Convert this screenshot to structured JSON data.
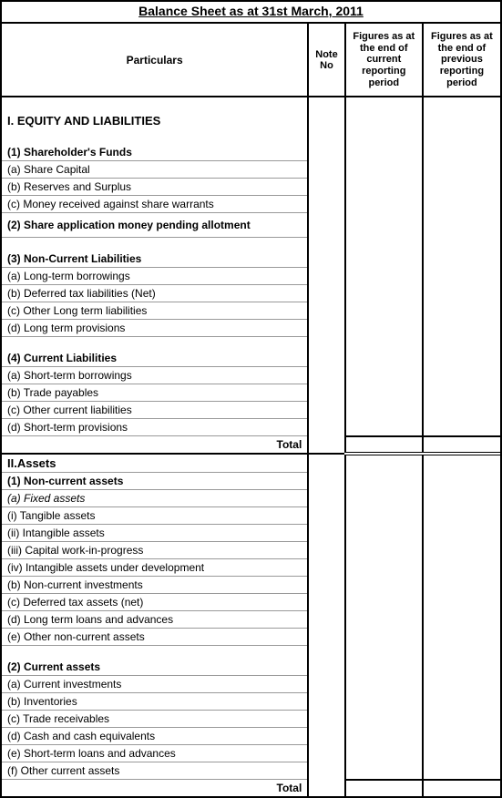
{
  "title": "Balance Sheet as at 31st March, 2011",
  "headers": {
    "particulars": "Particulars",
    "note_no": "Note No",
    "figures_current": "Figures as at the end of current reporting period",
    "figures_previous": "Figures as at the end of previous reporting period"
  },
  "sections": {
    "sec1_head": "I. EQUITY AND LIABILITIES",
    "shareholders_funds": "(1) Shareholder's Funds",
    "share_capital": "(a) Share Capital",
    "reserves_surplus": "(b) Reserves and Surplus",
    "money_warrants": "(c) Money received against share warrants",
    "share_app_pending": "(2) Share application money pending allotment",
    "non_current_liab": "(3) Non-Current Liabilities",
    "lt_borrowings": "(a) Long-term borrowings",
    "def_tax_liab": "(b) Deferred tax liabilities (Net)",
    "other_lt_liab": "(c) Other Long term liabilities",
    "lt_provisions": "(d) Long term provisions",
    "current_liab": "(4) Current Liabilities",
    "st_borrowings": "(a) Short-term borrowings",
    "trade_payables": "(b) Trade payables",
    "other_cur_liab": "(c) Other current liabilities",
    "st_provisions": "(d) Short-term provisions",
    "total1": "Total",
    "sec2_head": "II.Assets",
    "non_current_assets": "(1) Non-current assets",
    "fixed_assets": "(a) Fixed assets",
    "tangible": "(i) Tangible assets",
    "intangible": "(ii) Intangible assets",
    "cwip": "(iii) Capital work-in-progress",
    "int_dev": "(iv) Intangible assets under development",
    "nci": "(b) Non-current investments",
    "dta": "(c) Deferred tax assets (net)",
    "lt_loans": "(d) Long term loans and advances",
    "other_nca": "(e) Other non-current assets",
    "current_assets": "(2) Current assets",
    "cur_inv": "(a) Current investments",
    "inventories": "(b) Inventories",
    "trade_rec": "(c) Trade receivables",
    "cash": "(d) Cash and cash equivalents",
    "st_loans": "(e) Short-term loans and advances",
    "other_ca": "(f) Other current assets",
    "total2": "Total"
  }
}
